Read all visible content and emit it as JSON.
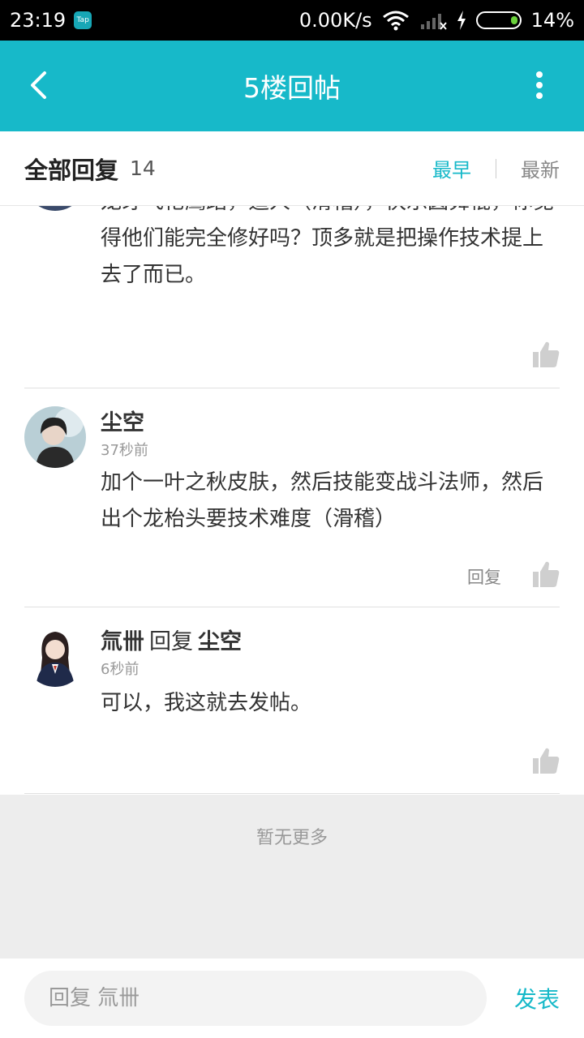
{
  "status": {
    "time": "23:19",
    "app_badge": "Tap",
    "net_speed": "0.00K/s",
    "battery": "14%"
  },
  "header": {
    "title": "5楼回帖"
  },
  "sort_bar": {
    "all_label": "全部回复",
    "count": "14",
    "earliest": "最早",
    "latest": "最新"
  },
  "replies": [
    {
      "body": "龙牙飞枪鹰踏，追人（滑稽），快乐圆舞棍，你觉得他们能完全修好吗？顶多就是把操作技术提上去了而已。"
    },
    {
      "name": "尘空",
      "time": "37秒前",
      "body": "加个一叶之秋皮肤，然后技能变战斗法师，然后出个龙枱头要技术难度（滑稽）",
      "reply_label": "回复"
    },
    {
      "name": "氚卌",
      "reply_word": "回复",
      "target": "尘空",
      "time": "6秒前",
      "body": "可以，我这就去发帖。"
    }
  ],
  "footer": {
    "no_more": "暂无更多"
  },
  "bottom": {
    "placeholder": "回复 氚卌",
    "send": "发表"
  },
  "colors": {
    "accent": "#17b9c9",
    "status_bg": "#000000"
  },
  "icons": [
    "back-arrow-icon",
    "more-vertical-icon",
    "thumbs-up-icon",
    "wifi-icon",
    "signal-icon",
    "battery-icon"
  ]
}
